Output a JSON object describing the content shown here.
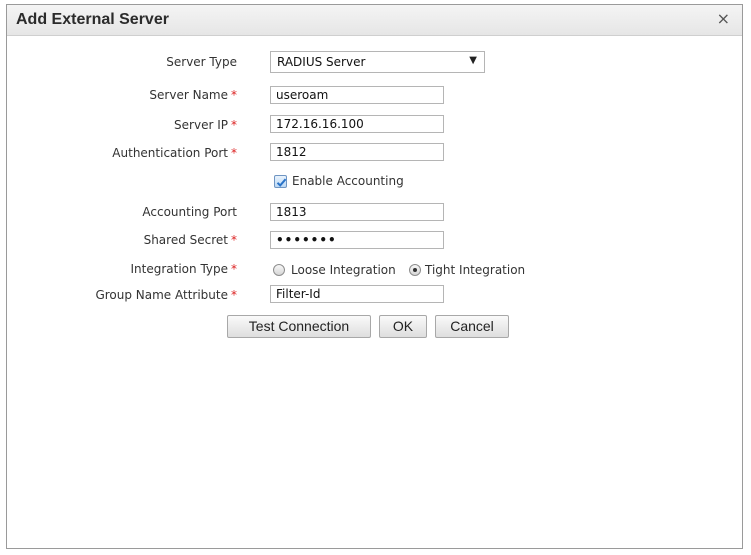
{
  "dialog": {
    "title": "Add External Server",
    "close_glyph": "×"
  },
  "form": {
    "server_type": {
      "label": "Server Type",
      "value": "RADIUS Server",
      "arrow": "▼"
    },
    "server_name": {
      "label": "Server Name",
      "value": "useroam",
      "required": "*"
    },
    "server_ip": {
      "label": "Server IP",
      "value": "172.16.16.100",
      "required": "*"
    },
    "auth_port": {
      "label": "Authentication Port",
      "value": "1812",
      "required": "*"
    },
    "enable_accounting": {
      "label": "Enable Accounting",
      "checked": true
    },
    "accounting_port": {
      "label": "Accounting Port",
      "value": "1813"
    },
    "shared_secret": {
      "label": "Shared Secret",
      "value": "•••••••",
      "required": "*"
    },
    "integration_type": {
      "label": "Integration Type",
      "required": "*",
      "options": [
        "Loose Integration",
        "Tight Integration"
      ],
      "selected": "Tight Integration"
    },
    "group_name_attribute": {
      "label": "Group Name Attribute",
      "value": "Filter-Id",
      "required": "*"
    }
  },
  "buttons": {
    "test_connection": "Test Connection",
    "ok": "OK",
    "cancel": "Cancel"
  },
  "colors": {
    "required_star": "#dd2222",
    "checkbox_accent": "#2a74c9"
  },
  "icons": {
    "close": "close-icon",
    "dropdown": "chevron-down-icon",
    "check": "checkmark-icon"
  }
}
